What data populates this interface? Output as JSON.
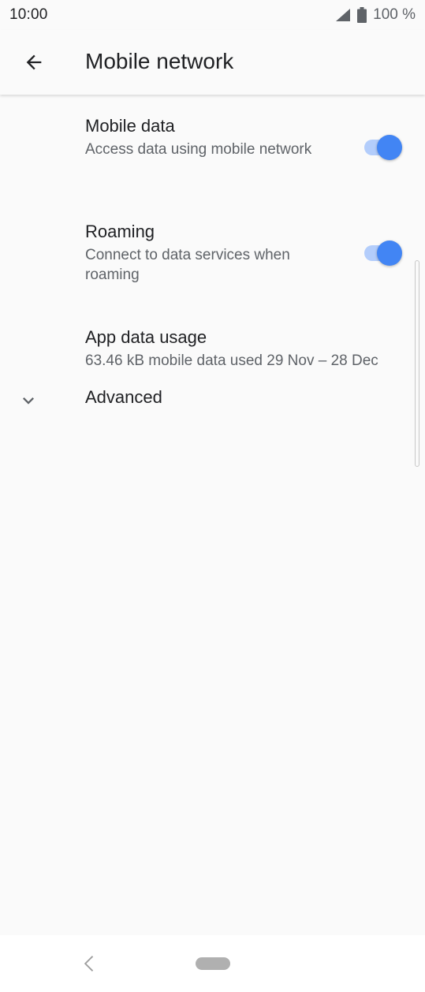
{
  "status_bar": {
    "time": "10:00",
    "battery_text": "100 %"
  },
  "app_bar": {
    "title": "Mobile network",
    "back_icon": "arrow-back-icon"
  },
  "preferences": {
    "mobile_data": {
      "title": "Mobile data",
      "summary": "Access data using mobile network",
      "enabled": true
    },
    "roaming": {
      "title": "Roaming",
      "summary": "Connect to data services when roaming",
      "enabled": true
    },
    "app_data_usage": {
      "title": "App data usage",
      "summary": "63.46 kB mobile data used 29 Nov – 28 Dec"
    },
    "advanced": {
      "title": "Advanced",
      "icon": "chevron-down-icon"
    }
  },
  "colors": {
    "accent": "#4285f4",
    "accent_track": "#b3cdfb",
    "background": "#fafafa"
  }
}
